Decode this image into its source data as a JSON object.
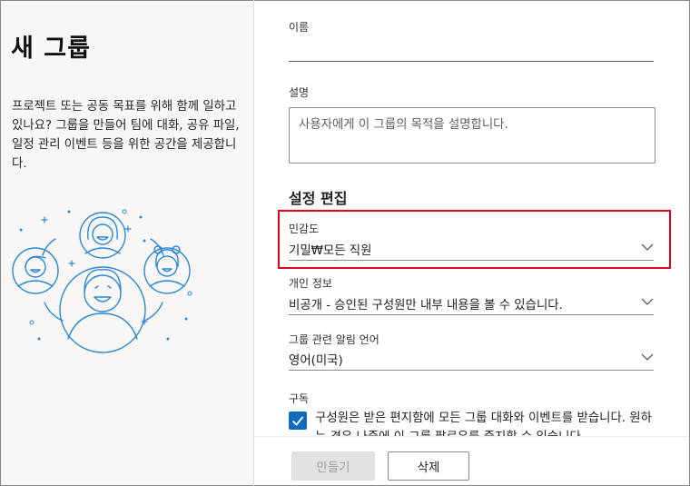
{
  "panel": {
    "title": "새 그룹",
    "description": "프로젝트 또는 공동 목표를 위해 함께 일하고 있나요? 그룹을 만들어 팀에 대화, 공유 파일, 일정 관리 이벤트 등을 위한 공간을 제공합니다."
  },
  "form": {
    "name_label": "이름",
    "name_value": "",
    "description_label": "설명",
    "description_placeholder": "사용자에게 이 그룹의 목적을 설명합니다.",
    "settings_heading": "설정 편집",
    "sensitivity_label": "민감도",
    "sensitivity_value": "기밀₩모든 직원",
    "privacy_label": "개인 정보",
    "privacy_value": "비공개 - 승인된 구성원만 내부 내용을 볼 수 있습니다.",
    "language_label": "그룹 관련 알림 언어",
    "language_value": "영어(미국)",
    "subscribe_label": "구독",
    "subscribe_text": "구성원은 받은 편지함에 모든 그룹 대화와 이벤트를 받습니다. 원하는 경우 나중에 이 그룹 팔로우를 중지할 수 있습니다.",
    "subscribe_checked": true
  },
  "footer": {
    "create_label": "만들기",
    "delete_label": "삭제"
  },
  "colors": {
    "accent": "#0f6cbd",
    "highlight": "#e3001b",
    "illustration": "#2b88d8"
  }
}
